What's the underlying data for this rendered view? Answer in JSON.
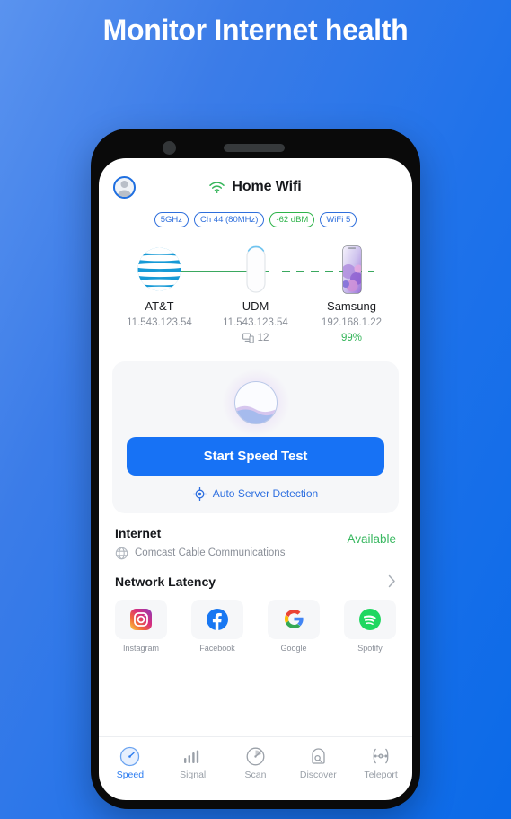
{
  "headline": "Monitor Internet health",
  "theme": {
    "bg_from": "#5a93ef",
    "bg_to": "#0b6ae8",
    "accent_blue": "#1772f5",
    "green": "#3ab861",
    "badge_blue": "#2f6fdc"
  },
  "app": {
    "avatar": "avatar-icon",
    "wifi_icon": "wifi-icon",
    "ssid": "Home Wifi",
    "badges": [
      {
        "label": "5GHz",
        "color": "blue"
      },
      {
        "label": "Ch 44 (80MHz)",
        "color": "blue"
      },
      {
        "label": "-62 dBM",
        "color": "green"
      },
      {
        "label": "WiFi 5",
        "color": "blue"
      }
    ],
    "topology": {
      "nodes": [
        {
          "name": "AT&T",
          "ip": "11.543.123.54",
          "sub": "",
          "icon": "att-globe-icon"
        },
        {
          "name": "UDM",
          "ip": "11.543.123.54",
          "sub": "12",
          "icon": "router-icon"
        },
        {
          "name": "Samsung",
          "ip": "192.168.1.22",
          "sub": "99%",
          "icon": "phone-device-icon"
        }
      ],
      "link_solid": "solid-green-line",
      "link_dashed": "dashed-green-line"
    },
    "speed_card": {
      "orb": "speed-orb",
      "button_label": "Start Speed Test",
      "auto_server_label": "Auto Server Detection",
      "auto_server_icon": "target-icon"
    },
    "internet": {
      "title": "Internet",
      "isp": "Comcast Cable Communications",
      "isp_icon": "globe-icon",
      "status": "Available"
    },
    "latency": {
      "title": "Network Latency",
      "chevron": "chevron-right-icon"
    },
    "apps": [
      {
        "name": "Instagram",
        "icon": "instagram-icon"
      },
      {
        "name": "Facebook",
        "icon": "facebook-icon"
      },
      {
        "name": "Google",
        "icon": "google-icon"
      },
      {
        "name": "Spotify",
        "icon": "spotify-icon"
      }
    ],
    "nav": [
      {
        "label": "Speed",
        "icon": "speedometer-icon",
        "active": true
      },
      {
        "label": "Signal",
        "icon": "signal-bars-icon",
        "active": false
      },
      {
        "label": "Scan",
        "icon": "radar-icon",
        "active": false
      },
      {
        "label": "Discover",
        "icon": "magnifier-icon",
        "active": false
      },
      {
        "label": "Teleport",
        "icon": "teleport-icon",
        "active": false
      }
    ]
  }
}
